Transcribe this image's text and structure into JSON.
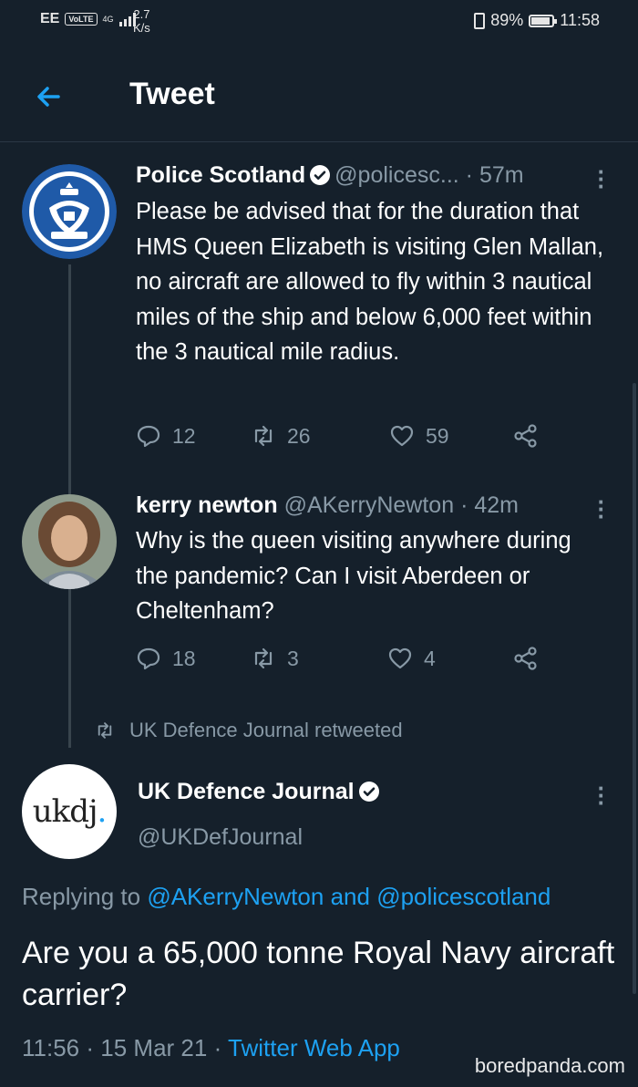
{
  "status_bar": {
    "carrier": "EE",
    "volte": "VoLTE",
    "network": "4G",
    "speed_value": "2.7",
    "speed_unit": "K/s",
    "battery": "89%",
    "battery_level": 0.89,
    "time": "11:58"
  },
  "header": {
    "title": "Tweet"
  },
  "tweets": [
    {
      "name": "Police Scotland",
      "handle": "@policesc...",
      "time": "· 57m",
      "text": "Please be advised that for the duration that HMS Queen Elizabeth is visiting Glen Mallan, no aircraft are allowed to fly within 3 nautical miles of the ship and below 6,000 feet within the 3 nautical mile radius.",
      "replies": "12",
      "retweets": "26",
      "likes": "59"
    },
    {
      "name": "kerry newton",
      "handle": "@AKerryNewton",
      "time": "· 42m",
      "text": "Why is the queen visiting anywhere during the pandemic?  Can I visit Aberdeen or Cheltenham?",
      "replies": "18",
      "retweets": "3",
      "likes": "4"
    }
  ],
  "retweet_context": "UK Defence Journal retweeted",
  "main_tweet": {
    "name": "UK Defence Journal",
    "handle": "@UKDefJournal",
    "avatar_text": "ukdj",
    "avatar_dot": ".",
    "replying_prefix": "Replying to",
    "replying_mention_1": "@AKerryNewton",
    "replying_and": "and",
    "replying_mention_2": "@policescotland",
    "text": "Are you a 65,000 tonne Royal Navy aircraft carrier?",
    "time": "11:56",
    "date": "15 Mar 21",
    "app": "Twitter Web App"
  },
  "watermark": "boredpanda.com",
  "colors": {
    "background": "#15202b",
    "accent": "#1da1f2",
    "secondary_text": "#8899a6",
    "police_blue": "#1f5aa8"
  }
}
